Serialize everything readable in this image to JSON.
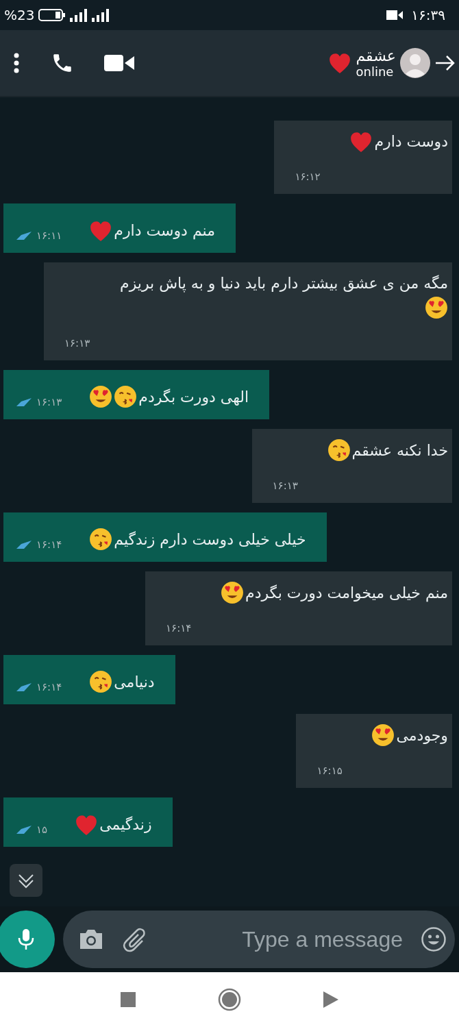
{
  "status_bar": {
    "battery": "%23",
    "time": "۱۶:۳۹"
  },
  "header": {
    "contact": "عشقم",
    "presence": "online"
  },
  "messages": [
    {
      "kind": "incoming",
      "text": "دوست دارم",
      "emoji": [
        {
          "kind": "heart"
        }
      ],
      "time": "۱۶:۱۲"
    },
    {
      "kind": "outgoing",
      "text": "منم دوست دارم",
      "emoji": [
        {
          "kind": "heart"
        }
      ],
      "time": "۱۶:۱۱"
    },
    {
      "kind": "incoming",
      "text": "مگه من ی عشق بیشتر دارم باید دنیا و به پاش بریزم",
      "emoji": [
        {
          "kind": "hearteyes"
        }
      ],
      "time": "۱۶:۱۳"
    },
    {
      "kind": "outgoing",
      "text": "الهی دورت بگردم",
      "emoji": [
        {
          "kind": "kiss"
        },
        {
          "kind": "hearteyes"
        }
      ],
      "time": "۱۶:۱۳"
    },
    {
      "kind": "incoming",
      "text": "خدا نکنه عشقم",
      "emoji": [
        {
          "kind": "kiss"
        }
      ],
      "time": "۱۶:۱۳"
    },
    {
      "kind": "outgoing",
      "text": "خیلی خیلی دوست دارم زندگیم",
      "emoji": [
        {
          "kind": "kiss"
        }
      ],
      "time": "۱۶:۱۴"
    },
    {
      "kind": "incoming",
      "text": "منم خیلی میخوامت دورت بگردم",
      "emoji": [
        {
          "kind": "hearteyes"
        }
      ],
      "time": "۱۶:۱۴"
    },
    {
      "kind": "outgoing",
      "text": "دنیامی",
      "emoji": [
        {
          "kind": "kiss"
        }
      ],
      "time": "۱۶:۱۴"
    },
    {
      "kind": "incoming",
      "text": "وجودمی",
      "emoji": [
        {
          "kind": "hearteyes"
        }
      ],
      "time": "۱۶:۱۵"
    },
    {
      "kind": "outgoing",
      "text": "زندگیمی",
      "emoji": [
        {
          "kind": "heart"
        }
      ],
      "time": "۱۵"
    }
  ],
  "composer": {
    "placeholder": "Type a message"
  }
}
